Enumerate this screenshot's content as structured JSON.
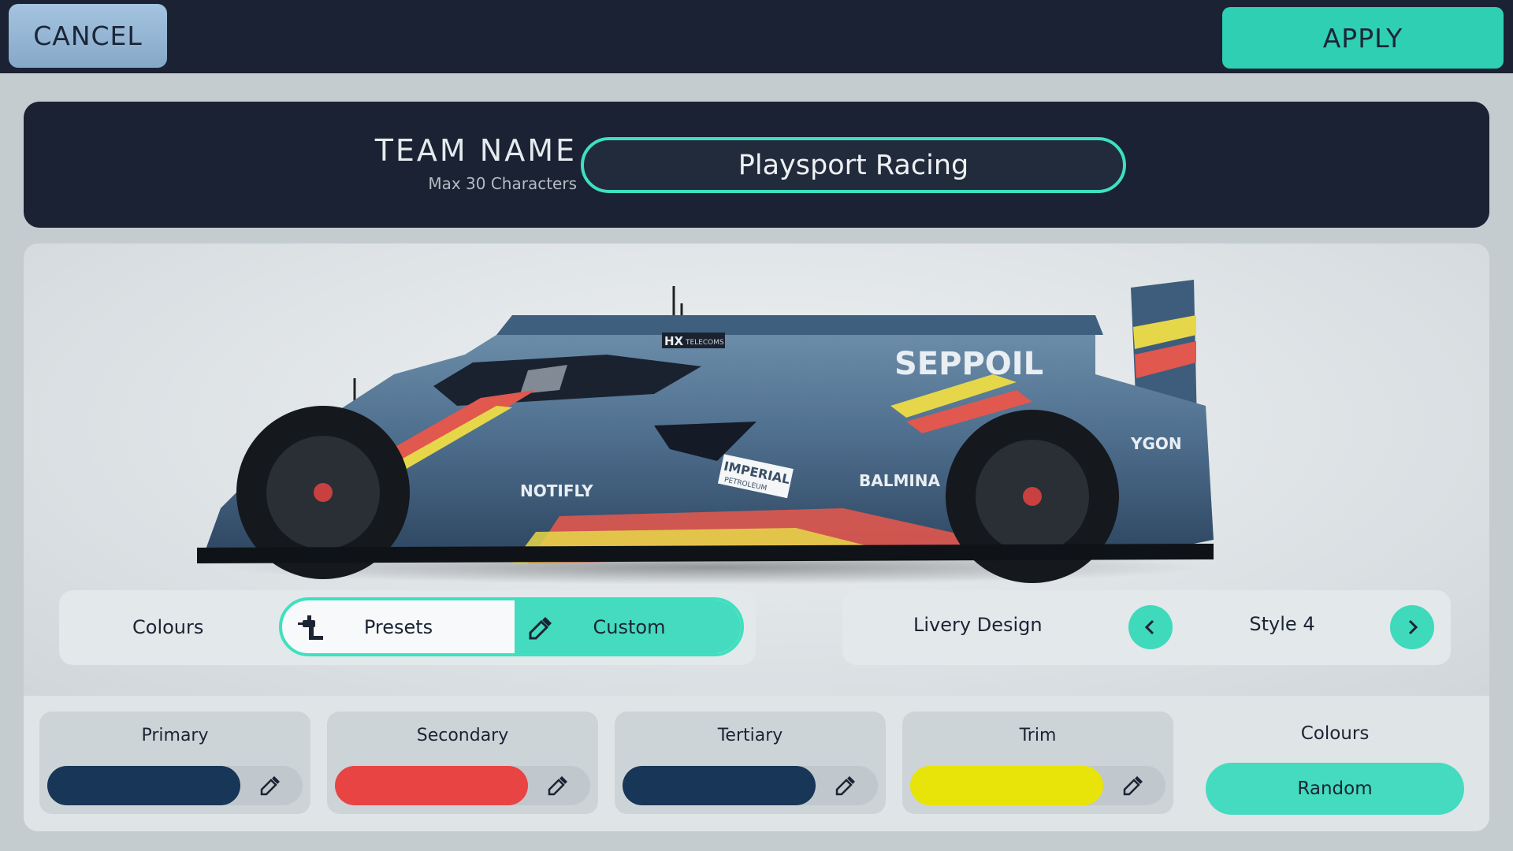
{
  "header": {
    "cancel_label": "CANCEL",
    "apply_label": "APPLY"
  },
  "team": {
    "label": "TEAM NAME",
    "hint": "Max 30 Characters",
    "value": "Playsport Racing"
  },
  "car": {
    "sponsors": [
      "SEPPOIL",
      "HX",
      "TELECOMS",
      "IMPERIAL",
      "PETROLEUM",
      "NOTIFLY",
      "BALMINA",
      "YGON"
    ]
  },
  "colours_mode": {
    "label": "Colours",
    "presets_label": "Presets",
    "custom_label": "Custom",
    "selected": "Custom"
  },
  "livery": {
    "label": "Livery Design",
    "style": "Style 4"
  },
  "colour_slots": [
    {
      "label": "Primary",
      "color": "#183657"
    },
    {
      "label": "Secondary",
      "color": "#e84444"
    },
    {
      "label": "Tertiary",
      "color": "#183657"
    },
    {
      "label": "Trim",
      "color": "#e8e40a"
    }
  ],
  "random": {
    "label": "Colours",
    "button_label": "Random"
  },
  "accent_color": "#44dbc0"
}
